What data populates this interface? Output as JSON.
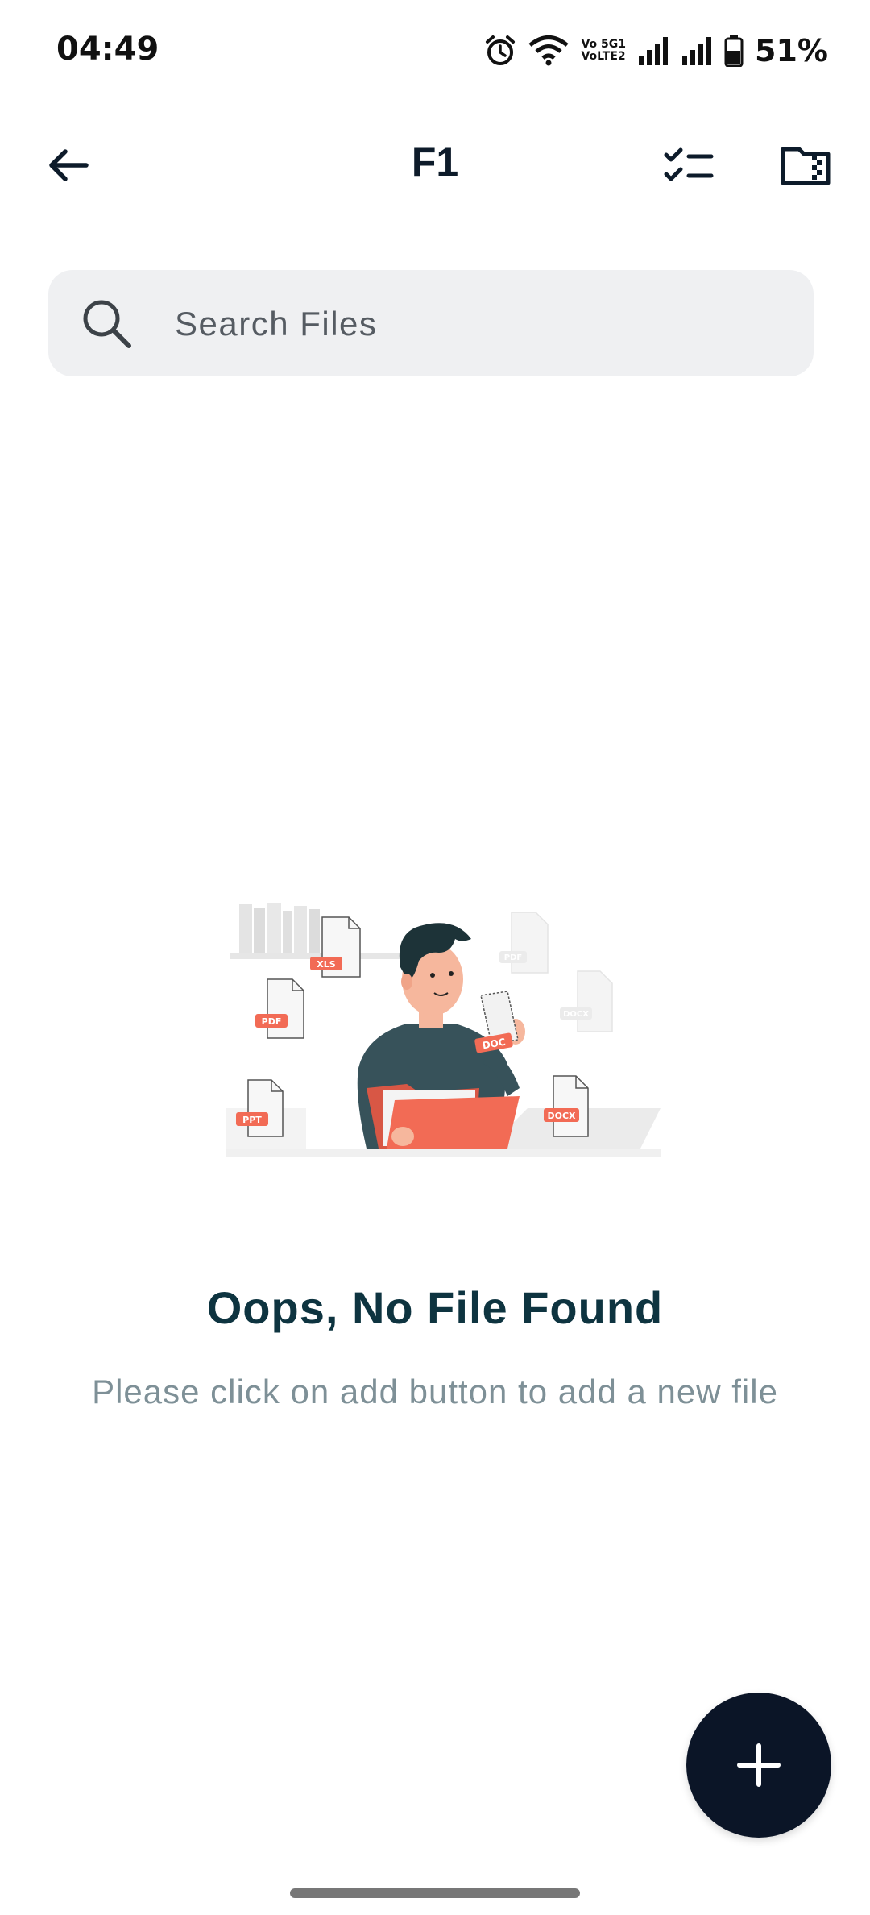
{
  "status_bar": {
    "time": "04:49",
    "volte_top": "Vo 5G1",
    "volte_bottom": "VoLTE2",
    "battery": "51%",
    "battery_level": 0.51,
    "icons": [
      "alarm-icon",
      "wifi-icon",
      "signal-icon",
      "signal-icon",
      "battery-icon"
    ]
  },
  "header": {
    "title": "F1",
    "icons": [
      "back-arrow-icon",
      "checklist-icon",
      "folder-zip-icon"
    ]
  },
  "search": {
    "placeholder": "Search Files",
    "value": ""
  },
  "empty_state": {
    "badges": {
      "xls": "XLS",
      "pdf": "PDF",
      "pdf_faded": "PDF",
      "docx_faded": "DOCX",
      "doc": "DOC",
      "ppt": "PPT",
      "docx": "DOCX"
    },
    "title": "Oops, No File Found",
    "message": "Please click on add button to add a new file"
  },
  "fab": {
    "icon": "plus-icon"
  },
  "colors": {
    "primary_dark": "#0b1527",
    "title_color": "#0e3440",
    "message_color": "#7e9097",
    "search_bg": "#eff0f2",
    "accent": "#f26b55"
  }
}
